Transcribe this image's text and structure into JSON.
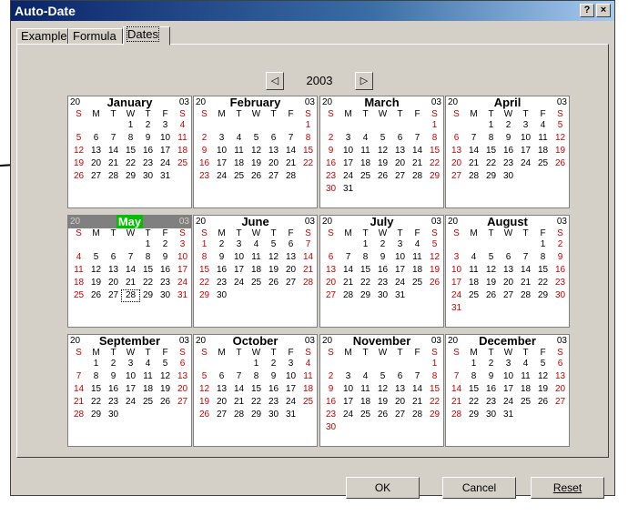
{
  "window": {
    "title": "Auto-Date",
    "help_label": "?",
    "close_label": "×"
  },
  "tabs": [
    {
      "label": "Example"
    },
    {
      "label": "Formula"
    },
    {
      "label": "Dates"
    }
  ],
  "year_control": {
    "prev_icon": "◁",
    "next_icon": "▷",
    "year": "2003"
  },
  "calendar": {
    "century": "20",
    "year": "03",
    "weekday_labels": [
      "S",
      "M",
      "T",
      "W",
      "T",
      "F",
      "S"
    ],
    "selected_month": "May",
    "today_day": 28,
    "months": [
      {
        "name": "January",
        "start": 3,
        "days": 31
      },
      {
        "name": "February",
        "start": 6,
        "days": 28
      },
      {
        "name": "March",
        "start": 6,
        "days": 31
      },
      {
        "name": "April",
        "start": 2,
        "days": 30
      },
      {
        "name": "May",
        "start": 4,
        "days": 31
      },
      {
        "name": "June",
        "start": 0,
        "days": 30
      },
      {
        "name": "July",
        "start": 2,
        "days": 31
      },
      {
        "name": "August",
        "start": 5,
        "days": 31
      },
      {
        "name": "September",
        "start": 1,
        "days": 30
      },
      {
        "name": "October",
        "start": 3,
        "days": 31
      },
      {
        "name": "November",
        "start": 6,
        "days": 30
      },
      {
        "name": "December",
        "start": 1,
        "days": 31
      }
    ]
  },
  "buttons": {
    "ok": "OK",
    "cancel": "Cancel",
    "reset": "Reset"
  },
  "colors": {
    "weekend": "#cc0000",
    "selected_month_bg": "#00c000",
    "titlebar": "#0a246a"
  }
}
